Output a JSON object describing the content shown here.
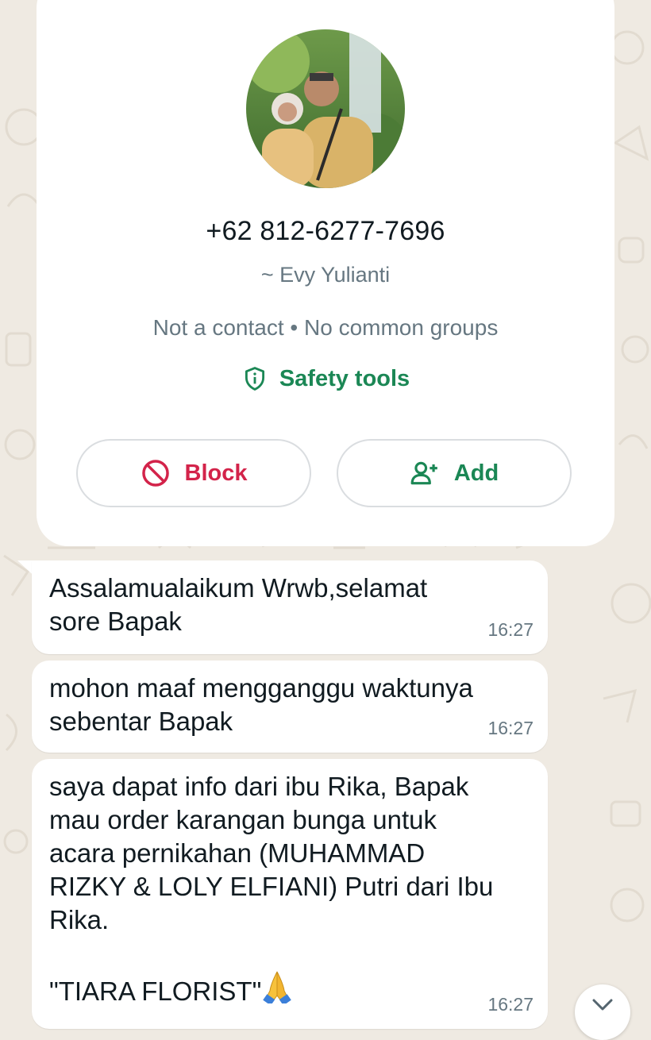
{
  "contact": {
    "phone": "+62 812-6277-7696",
    "push_name": "~ Evy Yulianti",
    "meta": "Not a contact • No common groups",
    "safety_label": "Safety tools",
    "block_label": "Block",
    "add_label": "Add",
    "avatar_icon": "profile-photo"
  },
  "messages": [
    {
      "text": "Assalamualaikum Wrwb,selamat\nsore Bapak",
      "time": "16:27"
    },
    {
      "text": "mohon maaf mengganggu waktunya\nsebentar Bapak",
      "time": "16:27"
    },
    {
      "text": "saya dapat info dari ibu Rika, Bapak\nmau order karangan bunga untuk\nacara pernikahan (MUHAMMAD\nRIZKY & LOLY ELFIANI) Putri dari Ibu\nRika.\n\n\"TIARA FLORIST\"",
      "time": "16:27",
      "emoji": "folded-hands"
    }
  ],
  "colors": {
    "background": "#efeae2",
    "accent_green": "#1b8755",
    "danger_red": "#d3234a",
    "secondary_text": "#667781"
  }
}
